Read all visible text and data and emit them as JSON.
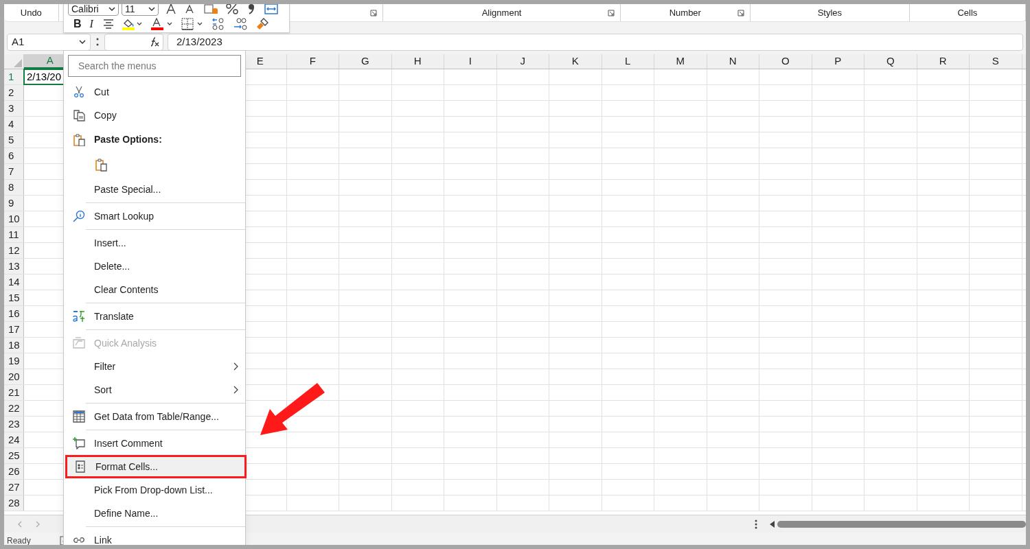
{
  "ribbon": {
    "undo_label": "Undo",
    "groups": [
      {
        "launcher": true
      },
      {
        "label": "Alignment",
        "launcher": true
      },
      {
        "label": "Number",
        "launcher": true
      },
      {
        "label": "Styles",
        "launcher": false
      },
      {
        "label": "Cells",
        "launcher": false
      }
    ]
  },
  "mini_toolbar": {
    "font": "Calibri",
    "size": "11",
    "bold_label": "B",
    "italic_label": "I"
  },
  "formula_bar": {
    "name_box": "A1",
    "formula": "2/13/2023"
  },
  "sheet": {
    "columns": [
      {
        "label": "A",
        "selected": true
      },
      {
        "label": "E",
        "selected": false
      },
      {
        "label": "F",
        "selected": false
      },
      {
        "label": "G",
        "selected": false
      },
      {
        "label": "H",
        "selected": false
      },
      {
        "label": "I",
        "selected": false
      },
      {
        "label": "J",
        "selected": false
      },
      {
        "label": "K",
        "selected": false
      },
      {
        "label": "L",
        "selected": false
      },
      {
        "label": "M",
        "selected": false
      },
      {
        "label": "N",
        "selected": false
      },
      {
        "label": "O",
        "selected": false
      },
      {
        "label": "P",
        "selected": false
      },
      {
        "label": "Q",
        "selected": false
      },
      {
        "label": "R",
        "selected": false
      },
      {
        "label": "S",
        "selected": false
      }
    ],
    "rows": [
      {
        "label": "1",
        "selected": true
      },
      {
        "label": "2",
        "selected": false
      },
      {
        "label": "3",
        "selected": false
      },
      {
        "label": "4",
        "selected": false
      },
      {
        "label": "5",
        "selected": false
      },
      {
        "label": "6",
        "selected": false
      },
      {
        "label": "7",
        "selected": false
      },
      {
        "label": "8",
        "selected": false
      },
      {
        "label": "9",
        "selected": false
      },
      {
        "label": "10",
        "selected": false
      },
      {
        "label": "11",
        "selected": false
      },
      {
        "label": "12",
        "selected": false
      },
      {
        "label": "13",
        "selected": false
      },
      {
        "label": "14",
        "selected": false
      },
      {
        "label": "15",
        "selected": false
      },
      {
        "label": "16",
        "selected": false
      },
      {
        "label": "17",
        "selected": false
      },
      {
        "label": "18",
        "selected": false
      },
      {
        "label": "19",
        "selected": false
      },
      {
        "label": "20",
        "selected": false
      },
      {
        "label": "21",
        "selected": false
      },
      {
        "label": "22",
        "selected": false
      },
      {
        "label": "23",
        "selected": false
      },
      {
        "label": "24",
        "selected": false
      },
      {
        "label": "25",
        "selected": false
      },
      {
        "label": "26",
        "selected": false
      },
      {
        "label": "27",
        "selected": false
      },
      {
        "label": "28",
        "selected": false
      }
    ],
    "active_cell": {
      "value": "2/13/20"
    }
  },
  "context_menu": {
    "search_placeholder": "Search the menus",
    "items": [
      {
        "kind": "item",
        "label": "Cut",
        "disabled": false,
        "submenu": false,
        "highlighted": false
      },
      {
        "kind": "item",
        "label": "Copy",
        "disabled": false,
        "submenu": false,
        "highlighted": false
      },
      {
        "kind": "header",
        "label": "Paste Options:"
      },
      {
        "kind": "paste_icons"
      },
      {
        "kind": "item",
        "label": "Paste Special...",
        "disabled": false,
        "submenu": false,
        "highlighted": false
      },
      {
        "kind": "separator"
      },
      {
        "kind": "item",
        "label": "Smart Lookup",
        "disabled": false,
        "submenu": false,
        "highlighted": false
      },
      {
        "kind": "separator"
      },
      {
        "kind": "item",
        "label": "Insert...",
        "disabled": false,
        "submenu": false,
        "highlighted": false
      },
      {
        "kind": "item",
        "label": "Delete...",
        "disabled": false,
        "submenu": false,
        "highlighted": false
      },
      {
        "kind": "item",
        "label": "Clear Contents",
        "disabled": false,
        "submenu": false,
        "highlighted": false
      },
      {
        "kind": "separator"
      },
      {
        "kind": "item",
        "label": "Translate",
        "disabled": false,
        "submenu": false,
        "highlighted": false
      },
      {
        "kind": "separator"
      },
      {
        "kind": "item",
        "label": "Quick Analysis",
        "disabled": true,
        "submenu": false,
        "highlighted": false
      },
      {
        "kind": "item",
        "label": "Filter",
        "disabled": false,
        "submenu": true,
        "highlighted": false
      },
      {
        "kind": "item",
        "label": "Sort",
        "disabled": false,
        "submenu": true,
        "highlighted": false
      },
      {
        "kind": "separator"
      },
      {
        "kind": "item",
        "label": "Get Data from Table/Range...",
        "disabled": false,
        "submenu": false,
        "highlighted": false
      },
      {
        "kind": "separator"
      },
      {
        "kind": "item",
        "label": "Insert Comment",
        "disabled": false,
        "submenu": false,
        "highlighted": false
      },
      {
        "kind": "item",
        "label": "Format Cells...",
        "disabled": false,
        "submenu": false,
        "highlighted": true
      },
      {
        "kind": "item",
        "label": "Pick From Drop-down List...",
        "disabled": false,
        "submenu": false,
        "highlighted": false
      },
      {
        "kind": "item",
        "label": "Define Name...",
        "disabled": false,
        "submenu": false,
        "highlighted": false
      },
      {
        "kind": "separator"
      },
      {
        "kind": "item",
        "label": "Link",
        "disabled": false,
        "submenu": false,
        "highlighted": false
      }
    ]
  },
  "status_bar": {
    "status": "Ready"
  }
}
